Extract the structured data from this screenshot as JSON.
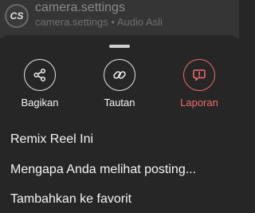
{
  "header": {
    "avatar_text": "CS",
    "account_name": "camera.settings",
    "account_subtitle": "camera.settings • Audio Asli"
  },
  "actions": [
    {
      "label": "Bagikan",
      "icon": "share-icon"
    },
    {
      "label": "Tautan",
      "icon": "link-icon"
    },
    {
      "label": "Laporan",
      "icon": "report-icon"
    }
  ],
  "menu": [
    {
      "label": "Remix Reel Ini"
    },
    {
      "label": "Mengapa Anda melihat posting..."
    },
    {
      "label": "Tambahkan ke favorit"
    }
  ],
  "colors": {
    "background": "#262626",
    "header_background": "#353535",
    "danger": "#f16a71",
    "text": "#f5f5f5"
  }
}
